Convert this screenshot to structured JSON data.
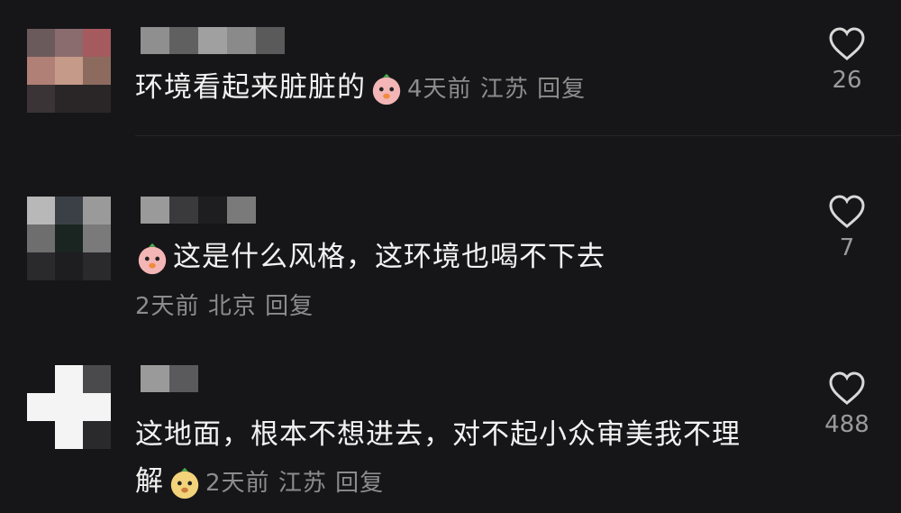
{
  "comments": [
    {
      "text": "环境看起来脏脏的",
      "time": "4天前",
      "location": "江苏",
      "reply_label": "回复",
      "likes": "26",
      "emoji": "chicken-emoji"
    },
    {
      "text": "这是什么风格，这环境也喝不下去",
      "time": "2天前",
      "location": "北京",
      "reply_label": "回复",
      "likes": "7",
      "emoji": "chicken-emoji"
    },
    {
      "text_line1": "这地面，根本不想进去，对不起小众审美我不理",
      "text_line2": "解",
      "time": "2天前",
      "location": "江苏",
      "reply_label": "回复",
      "likes": "488",
      "emoji": "dog-emoji"
    }
  ],
  "colors": {
    "background": "#161618",
    "text": "#f2f2f2",
    "meta": "#8c8c8c"
  }
}
